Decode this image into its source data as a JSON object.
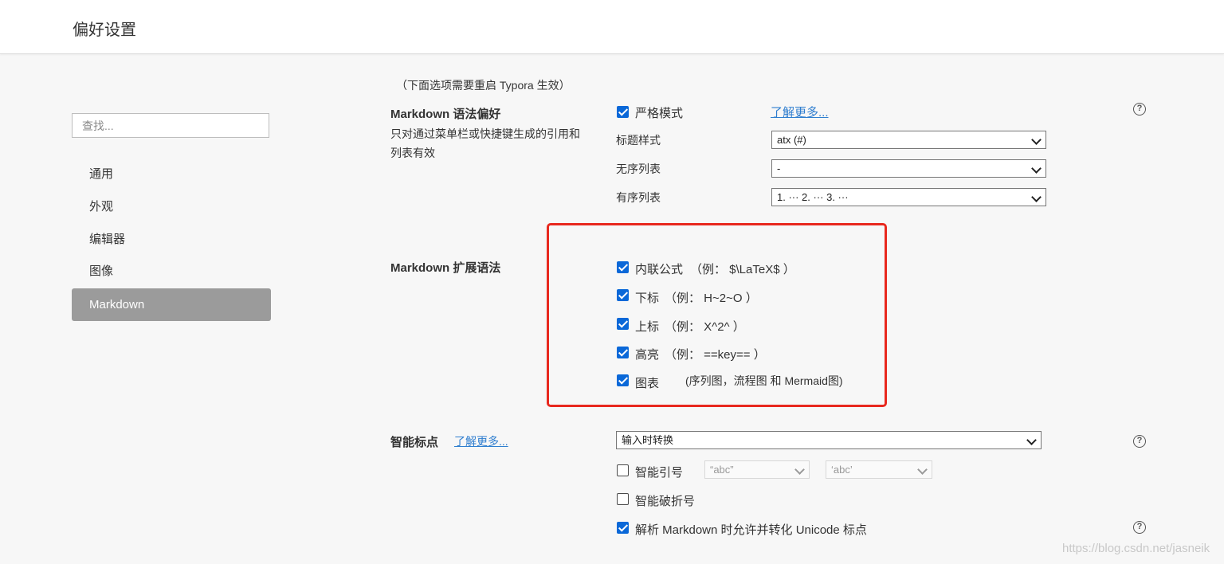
{
  "window": {
    "title": "偏好设置"
  },
  "search": {
    "placeholder": "查找..."
  },
  "sidebar": {
    "items": [
      {
        "label": "通用"
      },
      {
        "label": "外观"
      },
      {
        "label": "编辑器"
      },
      {
        "label": "图像"
      },
      {
        "label": "Markdown",
        "active": true
      }
    ]
  },
  "main": {
    "restart_note": "（下面选项需要重启 Typora 生效）",
    "syntax_pref": {
      "title": "Markdown 语法偏好",
      "desc": "只对通过菜单栏或快捷键生成的引用和列表有效",
      "strict_mode": {
        "label": "严格模式",
        "checked": true
      },
      "learn_more": "了解更多...",
      "heading_style": {
        "label": "标题样式",
        "value": "atx (#)"
      },
      "unordered_list": {
        "label": "无序列表",
        "value": "-"
      },
      "ordered_list": {
        "label": "有序列表",
        "value": "1. ··· 2. ··· 3. ···"
      }
    },
    "extended_syntax": {
      "title": "Markdown 扩展语法",
      "items": [
        {
          "label": "内联公式",
          "example": "（例： $\\LaTeX$ ）",
          "checked": true
        },
        {
          "label": "下标",
          "example": "（例： H~2~O ）",
          "checked": true
        },
        {
          "label": "上标",
          "example": "（例： X^2^ ）",
          "checked": true
        },
        {
          "label": "高亮",
          "example": "（例： ==key== ）",
          "checked": true
        },
        {
          "label": "图表",
          "example": "(序列图，流程图 和 Mermaid图)",
          "checked": true
        }
      ]
    },
    "smart_punct": {
      "title": "智能标点",
      "learn_more": "了解更多...",
      "mode": {
        "value": "输入时转换"
      },
      "smart_quotes": {
        "label": "智能引号",
        "checked": false,
        "double_value": "“abc”",
        "single_value": "‘abc’"
      },
      "smart_dash": {
        "label": "智能破折号",
        "checked": false
      },
      "unicode": {
        "label": "解析 Markdown 时允许并转化 Unicode 标点",
        "checked": true
      }
    }
  },
  "help_icon_text": "?",
  "watermark": "https://blog.csdn.net/jasneik",
  "colors": {
    "accent": "#0a68d8",
    "highlight_box": "#e8281e",
    "active_nav": "#9b9b9b",
    "link": "#2f7ecf"
  }
}
